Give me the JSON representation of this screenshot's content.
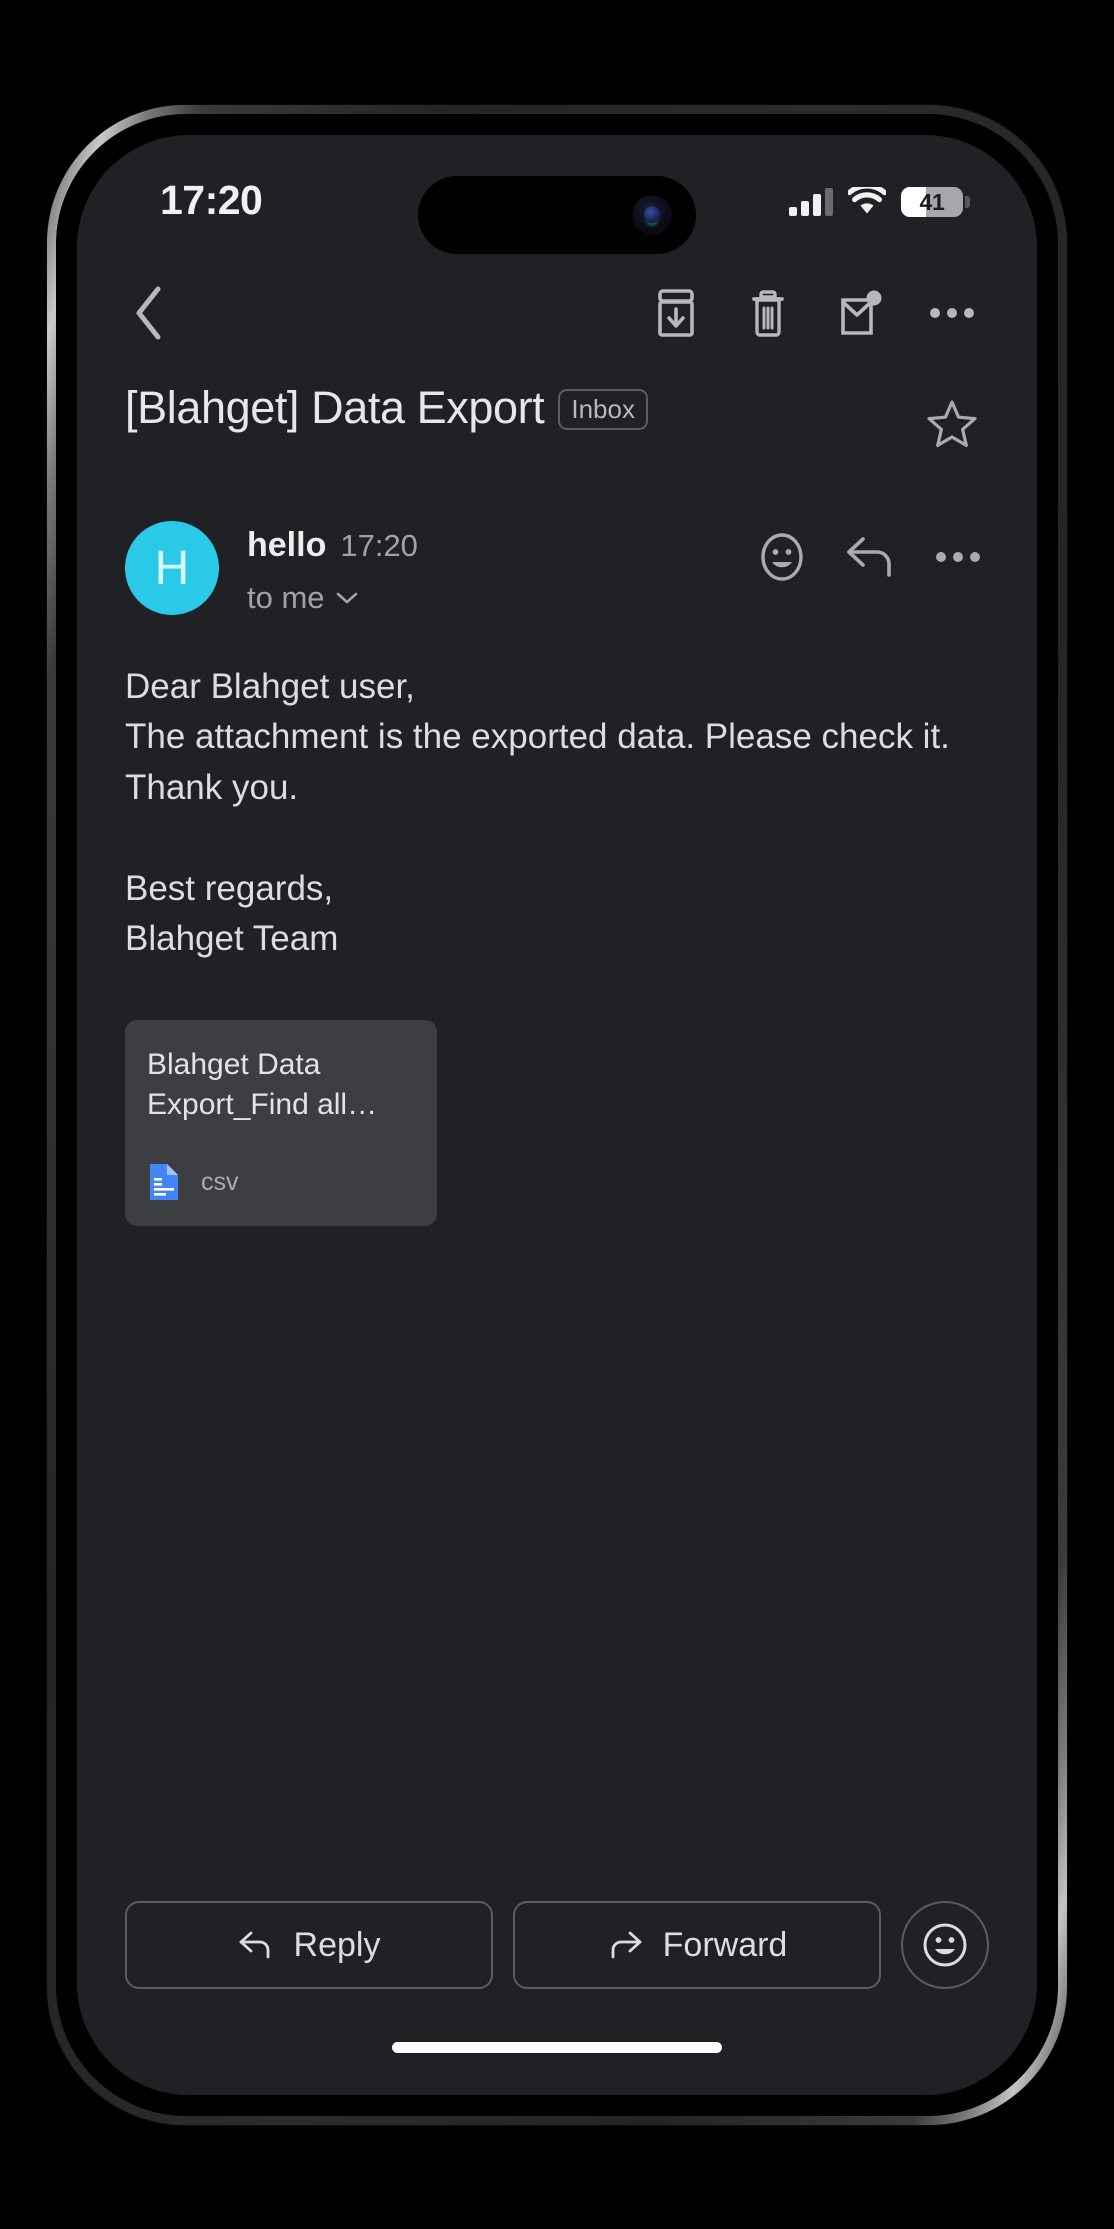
{
  "status_bar": {
    "time": "17:20",
    "battery_percent": "41",
    "battery_level": 41,
    "signal_bars_filled": 3,
    "signal_bars_total": 4,
    "wifi": "wifi-icon"
  },
  "toolbar": {
    "back": "back-chevron-icon",
    "archive": "archive-icon",
    "delete": "trash-icon",
    "mark_unread": "mark-unread-icon",
    "more": "more-options-icon"
  },
  "subject": {
    "title": "[Blahget] Data Export",
    "label_badge": "Inbox",
    "star": "star-outline-icon"
  },
  "message": {
    "avatar_initial": "H",
    "avatar_color": "#2AC9E8",
    "sender": "hello",
    "time": "17:20",
    "recipient": "to me",
    "recipient_chevron": "chevron-down-icon",
    "actions": {
      "emoji": "emoji-reaction-icon",
      "reply": "reply-arrow-icon",
      "more": "more-options-icon"
    },
    "body": "Dear Blahget user,\nThe attachment is the exported data. Please check it. Thank you.\n\nBest regards,\nBlahget Team"
  },
  "attachment": {
    "name": "Blahget Data Export_Find all…",
    "file_type": "csv",
    "icon": "csv-file-icon",
    "icon_color": "#4285F4"
  },
  "bottom_bar": {
    "reply_label": "Reply",
    "reply_icon": "reply-arrow-icon",
    "forward_label": "Forward",
    "forward_icon": "forward-arrow-icon",
    "emoji_icon": "emoji-reaction-icon"
  },
  "theme": {
    "screen_bg": "#202124",
    "card_bg": "#3C3E41",
    "text_primary": "#E6E7E8",
    "text_secondary": "#A0A2A5",
    "icon_color": "#A9ABAE"
  }
}
